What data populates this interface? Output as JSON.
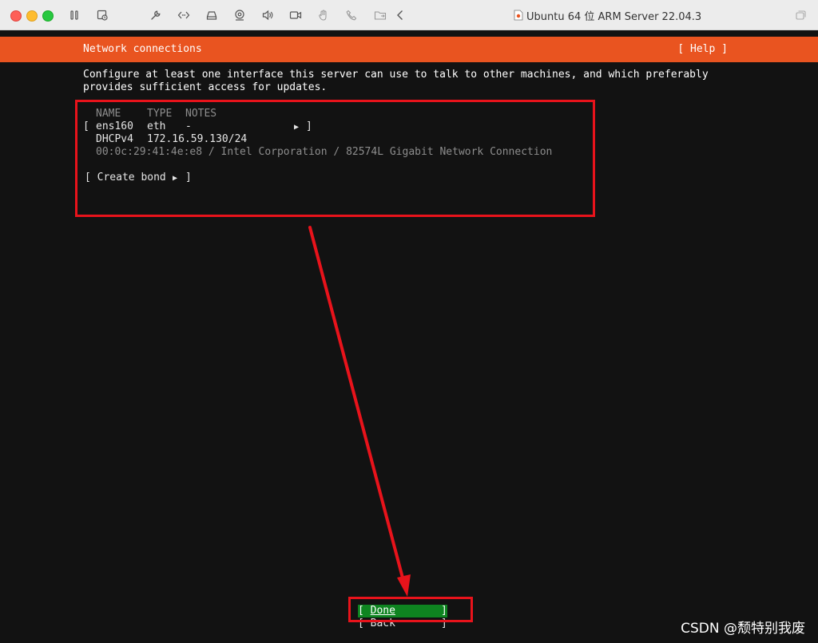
{
  "window": {
    "title": "Ubuntu 64 位 ARM Server 22.04.3",
    "toolbar_icons": [
      "pause-icon",
      "snapshot-icon",
      "wrench-icon",
      "code-icon",
      "disk-icon",
      "camera-device-icon",
      "volume-icon",
      "video-icon",
      "hand-icon",
      "phone-icon",
      "folder-icon",
      "back-chevron-icon",
      "window-icon"
    ]
  },
  "header": {
    "title": "Network connections",
    "help": "[ Help ]"
  },
  "description": {
    "line1": "Configure at least one interface this server can use to talk to other machines, and which preferably",
    "line2": "provides sufficient access for updates."
  },
  "table": {
    "headers": {
      "name": "NAME",
      "type": "TYPE",
      "notes": "NOTES"
    },
    "interface": {
      "open_bracket": "[",
      "name": "ens160",
      "type": "eth",
      "notes": "-",
      "arrow": "▶",
      "close_bracket": "]"
    },
    "dhcp": {
      "label": "DHCPv4",
      "address": "172.16.59.130/24"
    },
    "hardware": "00:0c:29:41:4e:e8 / Intel Corporation / 82574L Gigabit Network Connection",
    "create_bond": {
      "open": "[ Create bond",
      "arrow": "▶",
      "close": "]"
    }
  },
  "buttons": {
    "done_open": "[ ",
    "done_label": "Done",
    "done_close": "]",
    "back_open": "[ ",
    "back_label": "Back",
    "back_close": "]"
  },
  "watermark": "CSDN @颓特别我废",
  "colors": {
    "header": "#e95420",
    "screen": "#121212",
    "done_button": "#0e8420",
    "annotation": "#e8131b"
  }
}
